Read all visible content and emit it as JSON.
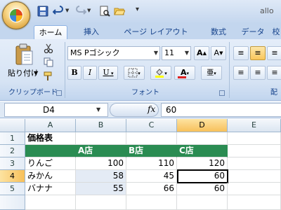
{
  "title_bar": {
    "window_title": "allo"
  },
  "tabs": [
    "ホーム",
    "挿入",
    "ページ レイアウト",
    "数式",
    "データ",
    "校"
  ],
  "clipboard": {
    "paste_label": "貼り付け",
    "group_label": "クリップボード"
  },
  "font_group": {
    "font_name": "MS Pゴシック",
    "font_size": "11",
    "group_label": "フォント",
    "bold": "B",
    "italic": "I",
    "underline": "U"
  },
  "alignment_group": {
    "group_label": "配"
  },
  "formula_bar": {
    "name_box": "D4",
    "fx": "fx",
    "formula": "60"
  },
  "grid": {
    "columns": [
      "A",
      "B",
      "C",
      "D",
      "E"
    ],
    "rows": [
      "1",
      "2",
      "3",
      "4",
      "5"
    ],
    "selected_column": "D",
    "selected_row": "4",
    "cells": {
      "A1": "価格表",
      "B2": "A店",
      "C2": "B店",
      "D2": "C店",
      "A3": "りんご",
      "B3": "100",
      "C3": "110",
      "D3": "120",
      "A4": "みかん",
      "B4": "58",
      "C4": "45",
      "D4": "60",
      "A5": "バナナ",
      "B5": "55",
      "C5": "66",
      "D5": "60"
    }
  },
  "colors": {
    "header_fill": "#2a8c52",
    "selection": "#f7c05a"
  }
}
